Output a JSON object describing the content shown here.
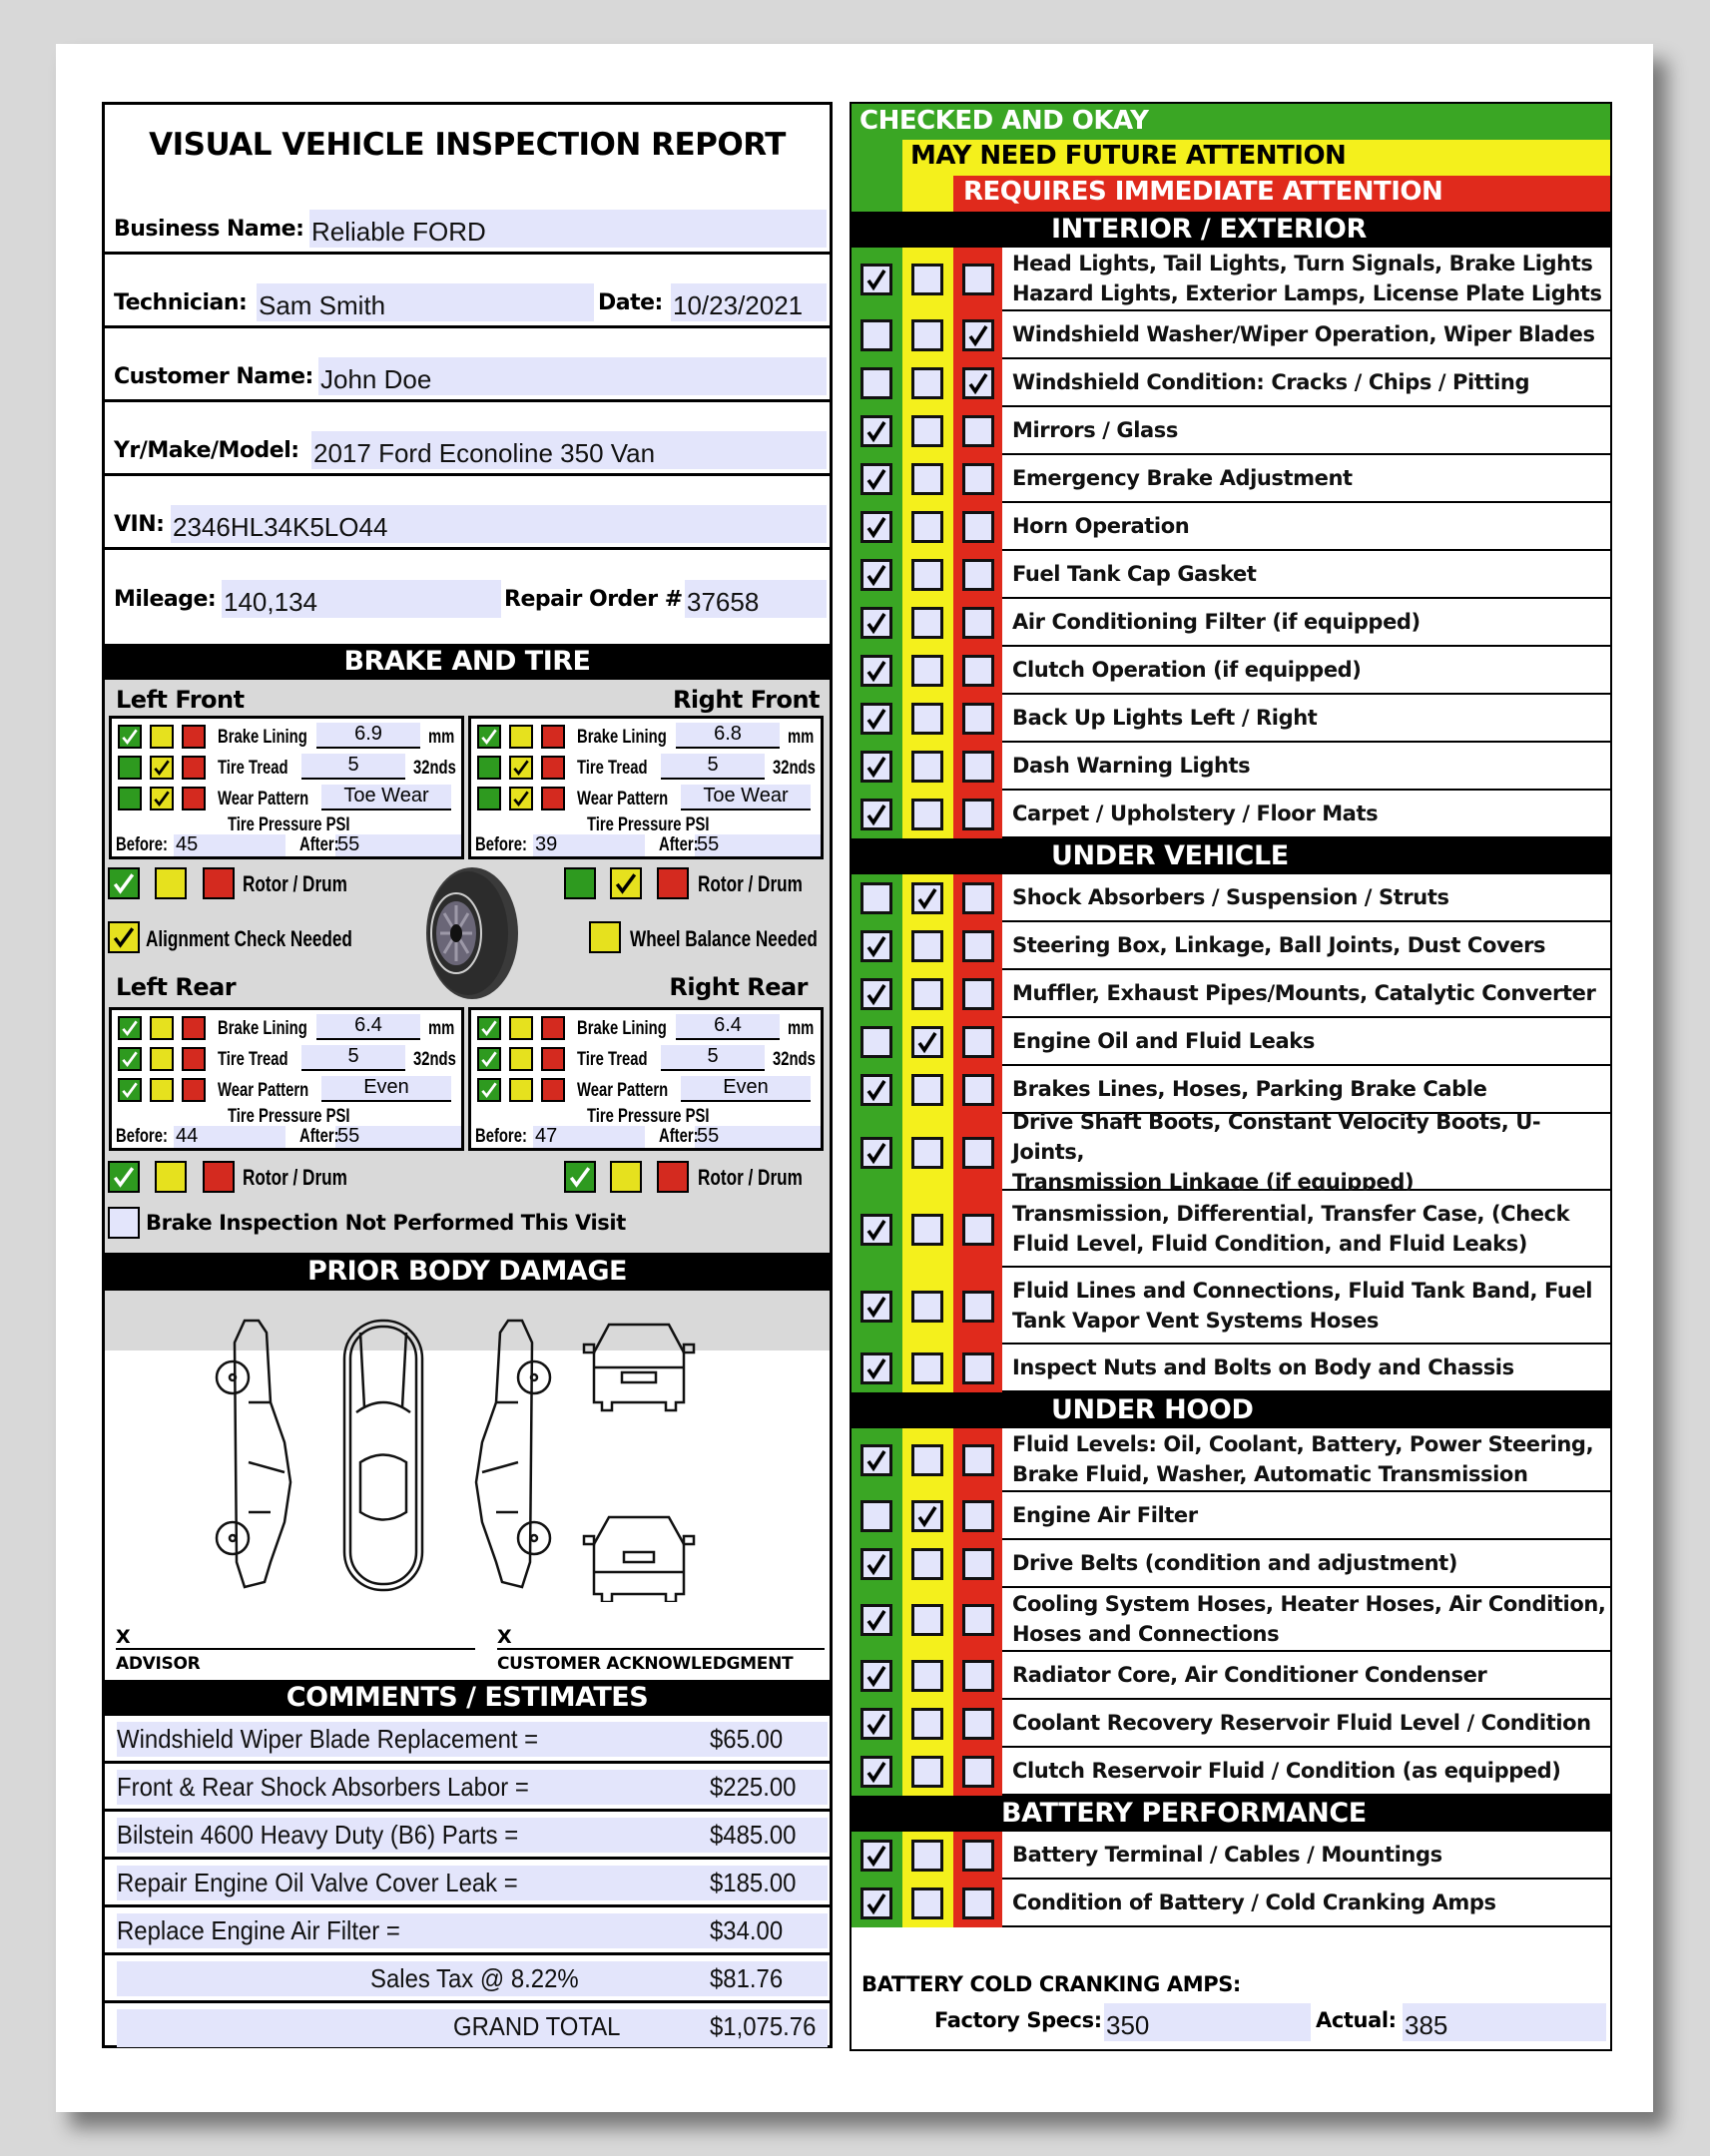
{
  "report_title": "VISUAL VEHICLE INSPECTION REPORT",
  "header_fields": {
    "business_name": {
      "label": "Business Name:",
      "value": "Reliable FORD"
    },
    "technician": {
      "label": "Technician:",
      "value": "Sam Smith"
    },
    "date": {
      "label": "Date:",
      "value": "10/23/2021"
    },
    "customer_name": {
      "label": "Customer Name:",
      "value": "John Doe"
    },
    "yr_make_model": {
      "label": "Yr/Make/Model:",
      "value": "2017 Ford Econoline 350 Van"
    },
    "vin": {
      "label": "VIN:",
      "value": "2346HL34K5LO44"
    },
    "mileage": {
      "label": "Mileage:",
      "value": "140,134"
    },
    "repair_order": {
      "label": "Repair Order #",
      "value": "37658"
    }
  },
  "brake_tire": {
    "heading": "BRAKE AND TIRE",
    "labels": {
      "brake_lining": "Brake Lining",
      "tire_tread": "Tire Tread",
      "wear_pattern": "Wear Pattern",
      "unit_mm": "mm",
      "unit_32nds": "32nds",
      "tire_pressure": "Tire Pressure PSI",
      "before": "Before:",
      "after": "After:",
      "rotor_drum": "Rotor / Drum"
    },
    "wheels": {
      "left_front": {
        "title": "Left Front",
        "brake_lining": "6.9",
        "tire_tread": "5",
        "wear_pattern": "Toe Wear",
        "before": "45",
        "after": "55",
        "status": {
          "brake_lining": "green",
          "tire_tread": "yellow",
          "wear_pattern": "yellow",
          "rotor_drum": "green"
        }
      },
      "right_front": {
        "title": "Right Front",
        "brake_lining": "6.8",
        "tire_tread": "5",
        "wear_pattern": "Toe Wear",
        "before": "39",
        "after": "55",
        "status": {
          "brake_lining": "green",
          "tire_tread": "yellow",
          "wear_pattern": "yellow",
          "rotor_drum": "yellow"
        }
      },
      "left_rear": {
        "title": "Left Rear",
        "brake_lining": "6.4",
        "tire_tread": "5",
        "wear_pattern": "Even",
        "before": "44",
        "after": "55",
        "status": {
          "brake_lining": "green",
          "tire_tread": "green",
          "wear_pattern": "green",
          "rotor_drum": "green"
        }
      },
      "right_rear": {
        "title": "Right Rear",
        "brake_lining": "6.4",
        "tire_tread": "5",
        "wear_pattern": "Even",
        "before": "47",
        "after": "55",
        "status": {
          "brake_lining": "green",
          "tire_tread": "green",
          "wear_pattern": "green",
          "rotor_drum": "green"
        }
      }
    },
    "alignment_check": {
      "label": "Alignment Check Needed",
      "checked": true
    },
    "wheel_balance": {
      "label": "Wheel Balance Needed",
      "checked": false
    },
    "not_performed": {
      "label": "Brake Inspection Not Performed This Visit",
      "checked": false
    }
  },
  "prior_body_damage": {
    "heading": "PRIOR BODY DAMAGE",
    "sign_mark": "X",
    "advisor_label": "ADVISOR",
    "customer_label": "CUSTOMER ACKNOWLEDGMENT"
  },
  "estimates": {
    "heading": "COMMENTS / ESTIMATES",
    "items": [
      {
        "desc": "Windshield Wiper Blade Replacement =",
        "amount": "$65.00"
      },
      {
        "desc": "Front & Rear Shock Absorbers Labor =",
        "amount": "$225.00"
      },
      {
        "desc": "Bilstein 4600 Heavy Duty (B6) Parts =",
        "amount": "$485.00"
      },
      {
        "desc": "Repair Engine Oil Valve Cover Leak =",
        "amount": "$185.00"
      },
      {
        "desc": "Replace Engine Air Filter =",
        "amount": "$34.00"
      }
    ],
    "sales_tax_label": "Sales Tax  @  8.22%",
    "sales_tax_amount": "$81.76",
    "grand_total_label": "GRAND  TOTAL",
    "grand_total_amount": "$1,075.76"
  },
  "legend": {
    "green": "CHECKED AND OKAY",
    "yellow": "MAY NEED FUTURE ATTENTION",
    "red": "REQUIRES IMMEDIATE ATTENTION",
    "colors": {
      "green": "#3aa624",
      "yellow": "#f4f01c",
      "red": "#e02a1c"
    }
  },
  "sections": [
    {
      "title": "INTERIOR / EXTERIOR",
      "items": [
        {
          "label": "Head Lights, Tail Lights, Turn Signals, Brake Lights\nHazard Lights, Exterior Lamps, License Plate Lights",
          "status": 0
        },
        {
          "label": "Windshield Washer/Wiper Operation, Wiper Blades",
          "status": 2
        },
        {
          "label": "Windshield Condition: Cracks / Chips / Pitting",
          "status": 2
        },
        {
          "label": "Mirrors / Glass",
          "status": 0
        },
        {
          "label": "Emergency Brake Adjustment",
          "status": 0
        },
        {
          "label": "Horn Operation",
          "status": 0
        },
        {
          "label": "Fuel Tank Cap Gasket",
          "status": 0
        },
        {
          "label": "Air Conditioning Filter (if equipped)",
          "status": 0
        },
        {
          "label": "Clutch Operation (if equipped)",
          "status": 0
        },
        {
          "label": "Back Up Lights Left / Right",
          "status": 0
        },
        {
          "label": "Dash Warning Lights",
          "status": 0
        },
        {
          "label": "Carpet / Upholstery / Floor Mats",
          "status": 0
        }
      ]
    },
    {
      "title": "UNDER VEHICLE",
      "items": [
        {
          "label": "Shock Absorbers / Suspension / Struts",
          "status": 1
        },
        {
          "label": "Steering Box, Linkage, Ball Joints, Dust Covers",
          "status": 0
        },
        {
          "label": "Muffler, Exhaust Pipes/Mounts, Catalytic Converter",
          "status": 0
        },
        {
          "label": "Engine Oil and Fluid Leaks",
          "status": 1
        },
        {
          "label": "Brakes Lines, Hoses, Parking Brake Cable",
          "status": 0
        },
        {
          "label": "Drive Shaft Boots, Constant Velocity Boots, U-Joints,\n Transmission Linkage (if equipped)",
          "status": 0
        },
        {
          "label": "Transmission, Differential, Transfer Case, (Check\nFluid Level, Fluid Condition, and Fluid Leaks)",
          "status": 0
        },
        {
          "label": "Fluid Lines and Connections, Fluid Tank Band, Fuel\nTank Vapor Vent Systems Hoses",
          "status": 0
        },
        {
          "label": "Inspect Nuts and Bolts on Body and Chassis",
          "status": 0
        }
      ]
    },
    {
      "title": "UNDER HOOD",
      "items": [
        {
          "label": "Fluid Levels: Oil, Coolant, Battery, Power Steering,\nBrake Fluid, Washer, Automatic Transmission",
          "status": 0
        },
        {
          "label": "Engine Air Filter",
          "status": 1
        },
        {
          "label": "Drive Belts (condition and adjustment)",
          "status": 0
        },
        {
          "label": "Cooling System Hoses, Heater Hoses, Air Condition,\nHoses and Connections",
          "status": 0
        },
        {
          "label": "Radiator Core, Air Conditioner Condenser",
          "status": 0
        },
        {
          "label": "Coolant Recovery Reservoir Fluid Level / Condition",
          "status": 0
        },
        {
          "label": "Clutch Reservoir Fluid / Condition (as equipped)",
          "status": 0
        }
      ]
    },
    {
      "title": "BATTERY PERFORMANCE",
      "items": [
        {
          "label": "Battery Terminal / Cables / Mountings",
          "status": 0
        },
        {
          "label": "Condition of Battery / Cold Cranking Amps",
          "status": 0
        }
      ]
    }
  ],
  "battery_cca": {
    "heading": "BATTERY COLD CRANKING AMPS:",
    "factory_label": "Factory Specs:",
    "factory_value": "350",
    "actual_label": "Actual:",
    "actual_value": "385"
  }
}
